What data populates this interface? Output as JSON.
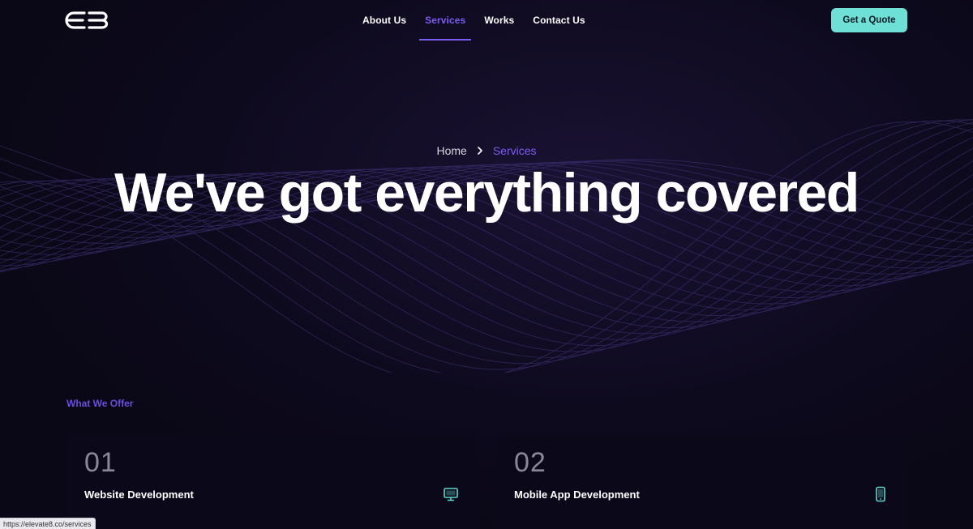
{
  "header": {
    "logo_alt": "eB",
    "nav": [
      {
        "label": "About Us",
        "active": false
      },
      {
        "label": "Services",
        "active": true
      },
      {
        "label": "Works",
        "active": false
      },
      {
        "label": "Contact Us",
        "active": false
      }
    ],
    "cta_label": "Get a Quote"
  },
  "hero": {
    "breadcrumb": {
      "home": "Home",
      "current": "Services"
    },
    "title": "We've got everything covered"
  },
  "offer": {
    "section_label": "What We Offer",
    "cards": [
      {
        "number": "01",
        "title": "Website Development",
        "icon": "monitor-icon",
        "text": ""
      },
      {
        "number": "02",
        "title": "Mobile App Development",
        "icon": "smartphone-icon",
        "text": ""
      }
    ]
  },
  "status_bar": {
    "url": "https://elevate8.co/services"
  },
  "colors": {
    "background": "#0a0716",
    "accent_purple": "#7b5cf0",
    "cta_teal": "#6fe0d6",
    "icon_teal": "#5fd6cc"
  }
}
